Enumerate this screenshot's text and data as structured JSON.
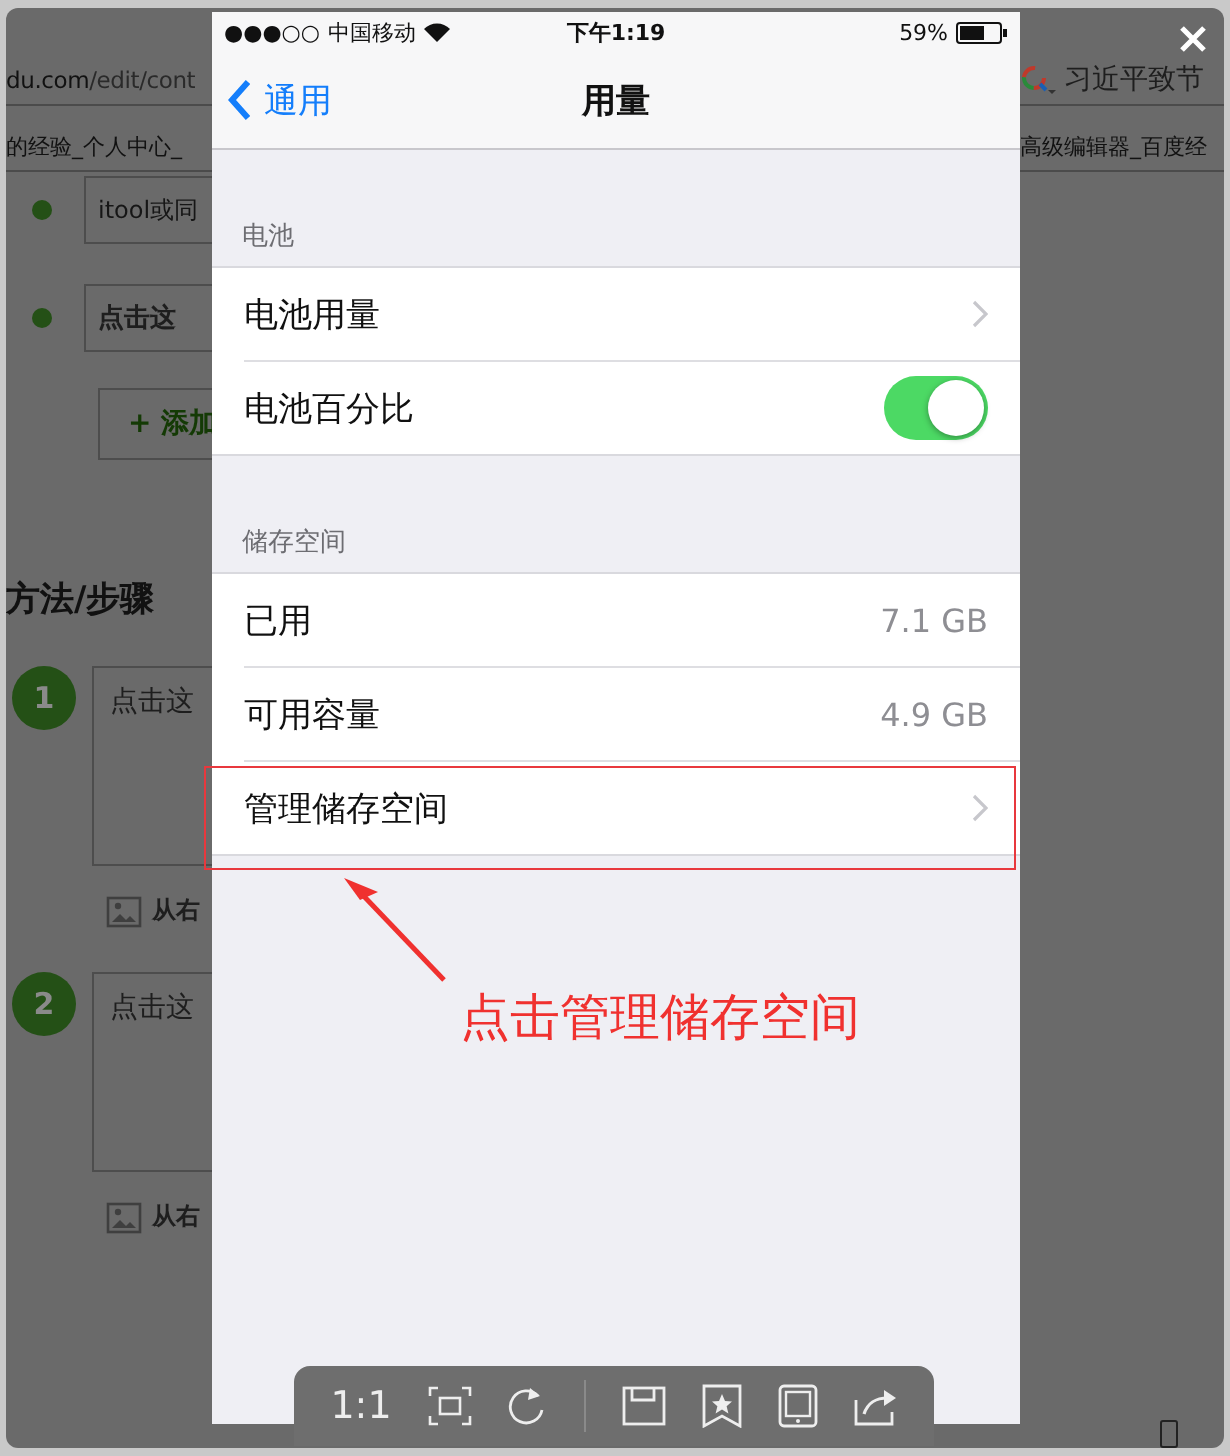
{
  "background_page": {
    "address": {
      "host": "du.com",
      "path": "/edit/cont"
    },
    "search": {
      "value": "习近平致节"
    },
    "bookmarks": [
      "的经验_个人中心_",
      "高级编辑器_百度经"
    ],
    "bullets": [
      {
        "text": "itool或同"
      },
      {
        "text": "点击这"
      }
    ],
    "add_button": "+ 添加",
    "section_title": "方法/步骤",
    "steps": [
      {
        "number": "1",
        "placeholder": "点击这",
        "image_hint": "从右"
      },
      {
        "number": "2",
        "placeholder": "点击这",
        "image_hint": "从右"
      }
    ]
  },
  "viewer": {
    "toolbar": {
      "zoom_label": "1:1"
    }
  },
  "phone": {
    "status_bar": {
      "signal": "●●●○○",
      "carrier": "中国移动",
      "time": "下午1:19",
      "battery": "59%"
    },
    "nav": {
      "back": "通用",
      "title": "用量"
    },
    "sections": [
      {
        "header": "电池",
        "rows": [
          {
            "kind": "link",
            "label": "电池用量",
            "highlighted": false
          },
          {
            "kind": "toggle",
            "label": "电池百分比",
            "on": true
          }
        ]
      },
      {
        "header": "储存空间",
        "rows": [
          {
            "kind": "value",
            "label": "已用",
            "value": "7.1 GB"
          },
          {
            "kind": "value",
            "label": "可用容量",
            "value": "4.9 GB"
          },
          {
            "kind": "link",
            "label": "管理储存空间",
            "highlighted": true
          }
        ]
      }
    ]
  },
  "annotation": {
    "text": "点击管理储存空间"
  }
}
